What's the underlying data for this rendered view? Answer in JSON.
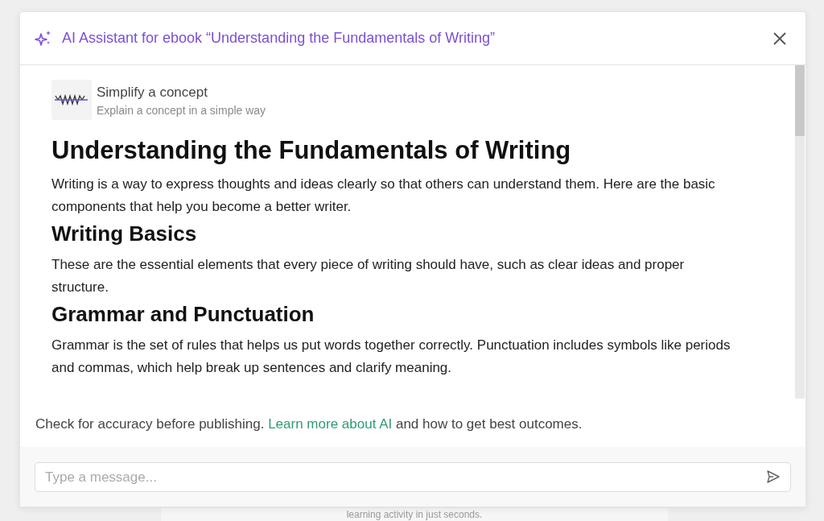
{
  "background": {
    "text": "learning activity in just seconds."
  },
  "dialog": {
    "title": "AI Assistant for ebook “Understanding the Fundamentals of Writing”",
    "action": {
      "title": "Simplify a concept",
      "subtitle": "Explain a concept in a simple way"
    },
    "content": [
      {
        "kind": "h1",
        "text": "Understanding the Fundamentals of Writing"
      },
      {
        "kind": "p",
        "text": "Writing is a way to express thoughts and ideas clearly so that others can understand them. Here are the basic components that help you become a better writer."
      },
      {
        "kind": "h2",
        "text": "Writing Basics"
      },
      {
        "kind": "p",
        "text": "These are the essential elements that every piece of writing should have, such as clear ideas and proper structure."
      },
      {
        "kind": "h2",
        "text": "Grammar and Punctuation"
      },
      {
        "kind": "p",
        "text": "Grammar is the set of rules that helps us put words together correctly. Punctuation includes symbols like periods and commas, which help break up sentences and clarify meaning."
      }
    ],
    "note": {
      "before": "Check for accuracy before publishing.",
      "link": "Learn more about AI",
      "after": "and how to get best outcomes."
    },
    "input": {
      "placeholder": "Type a message..."
    }
  }
}
